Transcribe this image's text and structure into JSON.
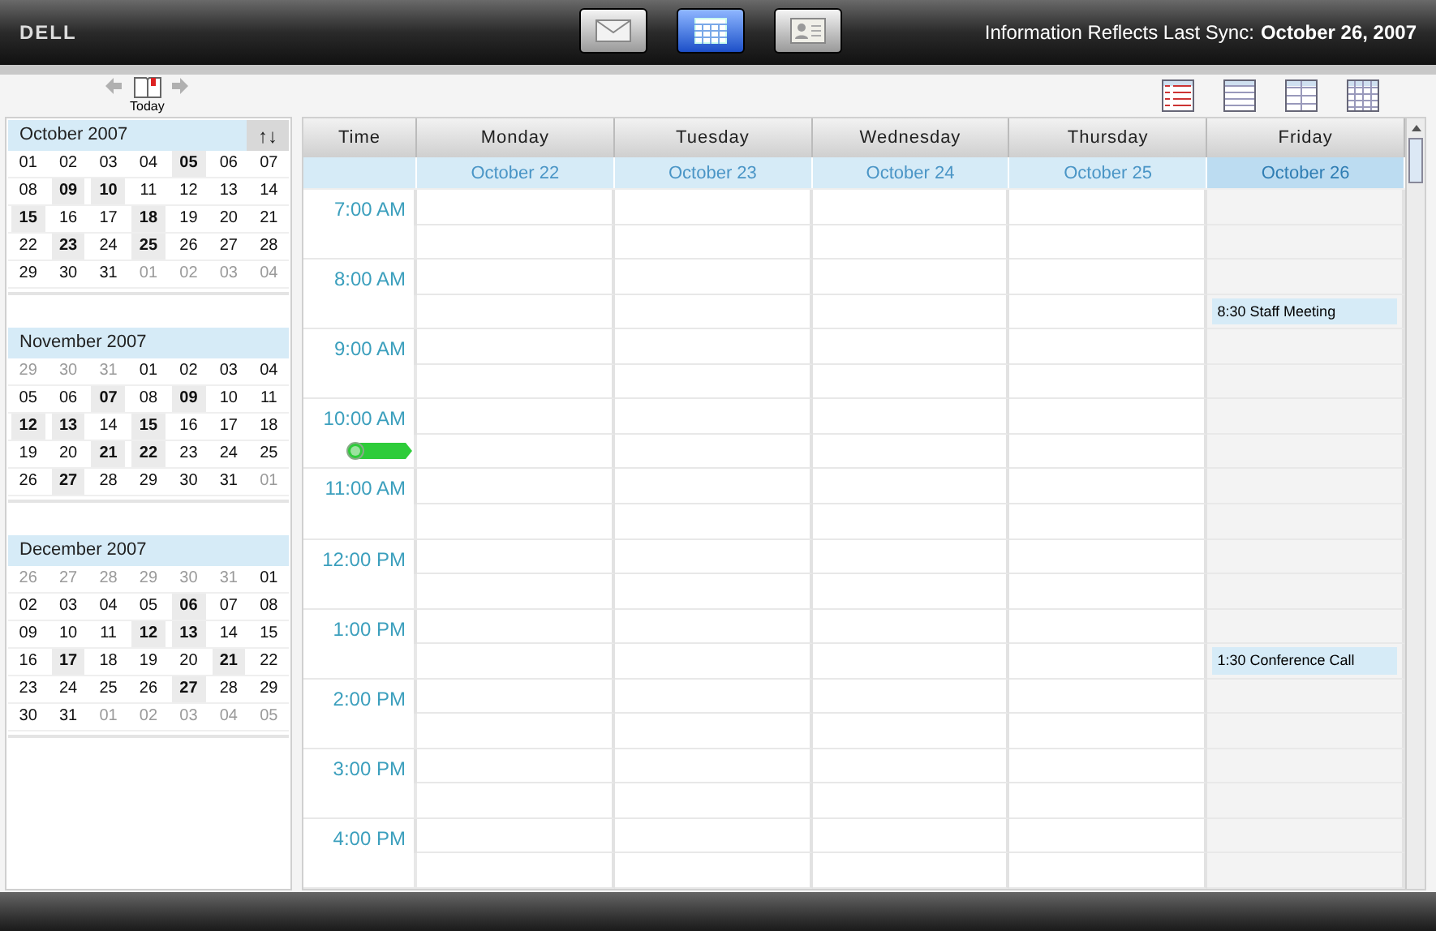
{
  "app": {
    "logo": "DELL",
    "nav": [
      {
        "kind": "mail",
        "selected": false
      },
      {
        "kind": "calendar",
        "selected": true
      },
      {
        "kind": "contacts",
        "selected": false
      }
    ],
    "sync_label": "Information Reflects Last Sync:",
    "sync_date": "October 26, 2007"
  },
  "toolbar": {
    "today": "Today",
    "views": [
      {
        "kind": "list"
      },
      {
        "kind": "day"
      },
      {
        "kind": "workweek"
      },
      {
        "kind": "month"
      }
    ]
  },
  "mini_calendars": [
    {
      "title": "October 2007",
      "sort": "↑↓",
      "weeks": [
        [
          {
            "day": "01",
            "has_events": false,
            "other_month": false
          },
          {
            "day": "02",
            "has_events": false,
            "other_month": false
          },
          {
            "day": "03",
            "has_events": false,
            "other_month": false
          },
          {
            "day": "04",
            "has_events": false,
            "other_month": false
          },
          {
            "day": "05",
            "has_events": true,
            "other_month": false
          },
          {
            "day": "06",
            "has_events": false,
            "other_month": false
          },
          {
            "day": "07",
            "has_events": false,
            "other_month": false
          }
        ],
        [
          {
            "day": "08",
            "has_events": false,
            "other_month": false
          },
          {
            "day": "09",
            "has_events": true,
            "other_month": false
          },
          {
            "day": "10",
            "has_events": true,
            "other_month": false
          },
          {
            "day": "11",
            "has_events": false,
            "other_month": false
          },
          {
            "day": "12",
            "has_events": false,
            "other_month": false
          },
          {
            "day": "13",
            "has_events": false,
            "other_month": false
          },
          {
            "day": "14",
            "has_events": false,
            "other_month": false
          }
        ],
        [
          {
            "day": "15",
            "has_events": true,
            "other_month": false
          },
          {
            "day": "16",
            "has_events": false,
            "other_month": false
          },
          {
            "day": "17",
            "has_events": false,
            "other_month": false
          },
          {
            "day": "18",
            "has_events": true,
            "other_month": false
          },
          {
            "day": "19",
            "has_events": false,
            "other_month": false
          },
          {
            "day": "20",
            "has_events": false,
            "other_month": false
          },
          {
            "day": "21",
            "has_events": false,
            "other_month": false
          }
        ],
        [
          {
            "day": "22",
            "has_events": false,
            "other_month": false
          },
          {
            "day": "23",
            "has_events": true,
            "other_month": false
          },
          {
            "day": "24",
            "has_events": false,
            "other_month": false
          },
          {
            "day": "25",
            "has_events": true,
            "other_month": false
          },
          {
            "day": "26",
            "has_events": false,
            "other_month": false
          },
          {
            "day": "27",
            "has_events": false,
            "other_month": false
          },
          {
            "day": "28",
            "has_events": false,
            "other_month": false
          }
        ],
        [
          {
            "day": "29",
            "has_events": false,
            "other_month": false
          },
          {
            "day": "30",
            "has_events": false,
            "other_month": false
          },
          {
            "day": "31",
            "has_events": false,
            "other_month": false
          },
          {
            "day": "01",
            "has_events": false,
            "other_month": true
          },
          {
            "day": "02",
            "has_events": false,
            "other_month": true
          },
          {
            "day": "03",
            "has_events": false,
            "other_month": true
          },
          {
            "day": "04",
            "has_events": false,
            "other_month": true
          }
        ]
      ]
    },
    {
      "title": "November 2007",
      "weeks": [
        [
          {
            "day": "29",
            "has_events": false,
            "other_month": true
          },
          {
            "day": "30",
            "has_events": false,
            "other_month": true
          },
          {
            "day": "31",
            "has_events": false,
            "other_month": true
          },
          {
            "day": "01",
            "has_events": false,
            "other_month": false
          },
          {
            "day": "02",
            "has_events": false,
            "other_month": false
          },
          {
            "day": "03",
            "has_events": false,
            "other_month": false
          },
          {
            "day": "04",
            "has_events": false,
            "other_month": false
          }
        ],
        [
          {
            "day": "05",
            "has_events": false,
            "other_month": false
          },
          {
            "day": "06",
            "has_events": false,
            "other_month": false
          },
          {
            "day": "07",
            "has_events": true,
            "other_month": false
          },
          {
            "day": "08",
            "has_events": false,
            "other_month": false
          },
          {
            "day": "09",
            "has_events": true,
            "other_month": false
          },
          {
            "day": "10",
            "has_events": false,
            "other_month": false
          },
          {
            "day": "11",
            "has_events": false,
            "other_month": false
          }
        ],
        [
          {
            "day": "12",
            "has_events": true,
            "other_month": false
          },
          {
            "day": "13",
            "has_events": true,
            "other_month": false
          },
          {
            "day": "14",
            "has_events": false,
            "other_month": false
          },
          {
            "day": "15",
            "has_events": true,
            "other_month": false
          },
          {
            "day": "16",
            "has_events": false,
            "other_month": false
          },
          {
            "day": "17",
            "has_events": false,
            "other_month": false
          },
          {
            "day": "18",
            "has_events": false,
            "other_month": false
          }
        ],
        [
          {
            "day": "19",
            "has_events": false,
            "other_month": false
          },
          {
            "day": "20",
            "has_events": false,
            "other_month": false
          },
          {
            "day": "21",
            "has_events": true,
            "other_month": false
          },
          {
            "day": "22",
            "has_events": true,
            "other_month": false
          },
          {
            "day": "23",
            "has_events": false,
            "other_month": false
          },
          {
            "day": "24",
            "has_events": false,
            "other_month": false
          },
          {
            "day": "25",
            "has_events": false,
            "other_month": false
          }
        ],
        [
          {
            "day": "26",
            "has_events": false,
            "other_month": false
          },
          {
            "day": "27",
            "has_events": true,
            "other_month": false
          },
          {
            "day": "28",
            "has_events": false,
            "other_month": false
          },
          {
            "day": "29",
            "has_events": false,
            "other_month": false
          },
          {
            "day": "30",
            "has_events": false,
            "other_month": false
          },
          {
            "day": "31",
            "has_events": false,
            "other_month": false
          },
          {
            "day": "01",
            "has_events": false,
            "other_month": true
          }
        ]
      ]
    },
    {
      "title": "December 2007",
      "weeks": [
        [
          {
            "day": "26",
            "has_events": false,
            "other_month": true
          },
          {
            "day": "27",
            "has_events": false,
            "other_month": true
          },
          {
            "day": "28",
            "has_events": false,
            "other_month": true
          },
          {
            "day": "29",
            "has_events": false,
            "other_month": true
          },
          {
            "day": "30",
            "has_events": false,
            "other_month": true
          },
          {
            "day": "31",
            "has_events": false,
            "other_month": true
          },
          {
            "day": "01",
            "has_events": false,
            "other_month": false
          }
        ],
        [
          {
            "day": "02",
            "has_events": false,
            "other_month": false
          },
          {
            "day": "03",
            "has_events": false,
            "other_month": false
          },
          {
            "day": "04",
            "has_events": false,
            "other_month": false
          },
          {
            "day": "05",
            "has_events": false,
            "other_month": false
          },
          {
            "day": "06",
            "has_events": true,
            "other_month": false
          },
          {
            "day": "07",
            "has_events": false,
            "other_month": false
          },
          {
            "day": "08",
            "has_events": false,
            "other_month": false
          }
        ],
        [
          {
            "day": "09",
            "has_events": false,
            "other_month": false
          },
          {
            "day": "10",
            "has_events": false,
            "other_month": false
          },
          {
            "day": "11",
            "has_events": false,
            "other_month": false
          },
          {
            "day": "12",
            "has_events": true,
            "other_month": false
          },
          {
            "day": "13",
            "has_events": true,
            "other_month": false
          },
          {
            "day": "14",
            "has_events": false,
            "other_month": false
          },
          {
            "day": "15",
            "has_events": false,
            "other_month": false
          }
        ],
        [
          {
            "day": "16",
            "has_events": false,
            "other_month": false
          },
          {
            "day": "17",
            "has_events": true,
            "other_month": false
          },
          {
            "day": "18",
            "has_events": false,
            "other_month": false
          },
          {
            "day": "19",
            "has_events": false,
            "other_month": false
          },
          {
            "day": "20",
            "has_events": false,
            "other_month": false
          },
          {
            "day": "21",
            "has_events": true,
            "other_month": false
          },
          {
            "day": "22",
            "has_events": false,
            "other_month": false
          }
        ],
        [
          {
            "day": "23",
            "has_events": false,
            "other_month": false
          },
          {
            "day": "24",
            "has_events": false,
            "other_month": false
          },
          {
            "day": "25",
            "has_events": false,
            "other_month": false
          },
          {
            "day": "26",
            "has_events": false,
            "other_month": false
          },
          {
            "day": "27",
            "has_events": true,
            "other_month": false
          },
          {
            "day": "28",
            "has_events": false,
            "other_month": false
          },
          {
            "day": "29",
            "has_events": false,
            "other_month": false
          }
        ],
        [
          {
            "day": "30",
            "has_events": false,
            "other_month": false
          },
          {
            "day": "31",
            "has_events": false,
            "other_month": false
          },
          {
            "day": "01",
            "has_events": false,
            "other_month": true
          },
          {
            "day": "02",
            "has_events": false,
            "other_month": true
          },
          {
            "day": "03",
            "has_events": false,
            "other_month": true
          },
          {
            "day": "04",
            "has_events": false,
            "other_month": true
          },
          {
            "day": "05",
            "has_events": false,
            "other_month": true
          }
        ]
      ]
    }
  ],
  "week": {
    "time_heading": "Time",
    "days": [
      {
        "name": "Monday",
        "date": "October 22",
        "selected": false
      },
      {
        "name": "Tuesday",
        "date": "October 23",
        "selected": false
      },
      {
        "name": "Wednesday",
        "date": "October 24",
        "selected": false
      },
      {
        "name": "Thursday",
        "date": "October 25",
        "selected": false
      },
      {
        "name": "Friday",
        "date": "October 26",
        "selected": true
      }
    ],
    "rows": [
      {
        "label": "7:00 AM",
        "now": false,
        "cells": [
          {
            "kind": "empty"
          },
          {
            "kind": "empty"
          },
          {
            "kind": "empty"
          },
          {
            "kind": "empty"
          },
          {
            "kind": "empty"
          }
        ]
      },
      {
        "now": false,
        "cells": [
          {
            "kind": "empty"
          },
          {
            "kind": "empty"
          },
          {
            "kind": "empty"
          },
          {
            "kind": "empty"
          },
          {
            "kind": "empty"
          }
        ]
      },
      {
        "label": "8:00 AM",
        "now": false,
        "cells": [
          {
            "kind": "empty"
          },
          {
            "kind": "empty"
          },
          {
            "kind": "empty"
          },
          {
            "kind": "empty"
          },
          {
            "kind": "empty"
          }
        ]
      },
      {
        "now": false,
        "cells": [
          {
            "kind": "empty"
          },
          {
            "kind": "empty"
          },
          {
            "kind": "empty"
          },
          {
            "kind": "empty"
          },
          {
            "kind": "event",
            "text": "8:30 Staff Meeting"
          }
        ]
      },
      {
        "label": "9:00 AM",
        "now": false,
        "cells": [
          {
            "kind": "empty"
          },
          {
            "kind": "empty"
          },
          {
            "kind": "empty"
          },
          {
            "kind": "empty"
          },
          {
            "kind": "empty"
          }
        ]
      },
      {
        "now": false,
        "cells": [
          {
            "kind": "empty"
          },
          {
            "kind": "empty"
          },
          {
            "kind": "empty"
          },
          {
            "kind": "empty"
          },
          {
            "kind": "empty"
          }
        ]
      },
      {
        "label": "10:00 AM",
        "now": false,
        "cells": [
          {
            "kind": "empty"
          },
          {
            "kind": "empty"
          },
          {
            "kind": "empty"
          },
          {
            "kind": "empty"
          },
          {
            "kind": "empty"
          }
        ]
      },
      {
        "now": true,
        "cells": [
          {
            "kind": "empty"
          },
          {
            "kind": "empty"
          },
          {
            "kind": "empty"
          },
          {
            "kind": "empty"
          },
          {
            "kind": "empty"
          }
        ]
      },
      {
        "label": "11:00 AM",
        "now": false,
        "cells": [
          {
            "kind": "empty"
          },
          {
            "kind": "empty"
          },
          {
            "kind": "empty"
          },
          {
            "kind": "empty"
          },
          {
            "kind": "empty"
          }
        ]
      },
      {
        "now": false,
        "cells": [
          {
            "kind": "empty"
          },
          {
            "kind": "empty"
          },
          {
            "kind": "empty"
          },
          {
            "kind": "empty"
          },
          {
            "kind": "empty"
          }
        ]
      },
      {
        "label": "12:00 PM",
        "now": false,
        "cells": [
          {
            "kind": "empty"
          },
          {
            "kind": "empty"
          },
          {
            "kind": "empty"
          },
          {
            "kind": "empty"
          },
          {
            "kind": "empty"
          }
        ]
      },
      {
        "now": false,
        "cells": [
          {
            "kind": "empty"
          },
          {
            "kind": "empty"
          },
          {
            "kind": "empty"
          },
          {
            "kind": "empty"
          },
          {
            "kind": "empty"
          }
        ]
      },
      {
        "label": "1:00 PM",
        "now": false,
        "cells": [
          {
            "kind": "empty"
          },
          {
            "kind": "empty"
          },
          {
            "kind": "empty"
          },
          {
            "kind": "empty"
          },
          {
            "kind": "empty"
          }
        ]
      },
      {
        "now": false,
        "cells": [
          {
            "kind": "empty"
          },
          {
            "kind": "empty"
          },
          {
            "kind": "empty"
          },
          {
            "kind": "empty"
          },
          {
            "kind": "event",
            "text": "1:30 Conference Call"
          }
        ]
      },
      {
        "label": "2:00 PM",
        "now": false,
        "cells": [
          {
            "kind": "empty"
          },
          {
            "kind": "empty"
          },
          {
            "kind": "empty"
          },
          {
            "kind": "empty"
          },
          {
            "kind": "empty"
          }
        ]
      },
      {
        "now": false,
        "cells": [
          {
            "kind": "empty"
          },
          {
            "kind": "empty"
          },
          {
            "kind": "empty"
          },
          {
            "kind": "empty"
          },
          {
            "kind": "empty"
          }
        ]
      },
      {
        "label": "3:00 PM",
        "now": false,
        "cells": [
          {
            "kind": "empty"
          },
          {
            "kind": "empty"
          },
          {
            "kind": "empty"
          },
          {
            "kind": "empty"
          },
          {
            "kind": "empty"
          }
        ]
      },
      {
        "now": false,
        "cells": [
          {
            "kind": "empty"
          },
          {
            "kind": "empty"
          },
          {
            "kind": "empty"
          },
          {
            "kind": "empty"
          },
          {
            "kind": "empty"
          }
        ]
      },
      {
        "label": "4:00 PM",
        "now": false,
        "cells": [
          {
            "kind": "empty"
          },
          {
            "kind": "empty"
          },
          {
            "kind": "empty"
          },
          {
            "kind": "empty"
          },
          {
            "kind": "empty"
          }
        ]
      },
      {
        "now": false,
        "cells": [
          {
            "kind": "empty"
          },
          {
            "kind": "empty"
          },
          {
            "kind": "empty"
          },
          {
            "kind": "empty"
          },
          {
            "kind": "empty"
          }
        ]
      }
    ]
  }
}
